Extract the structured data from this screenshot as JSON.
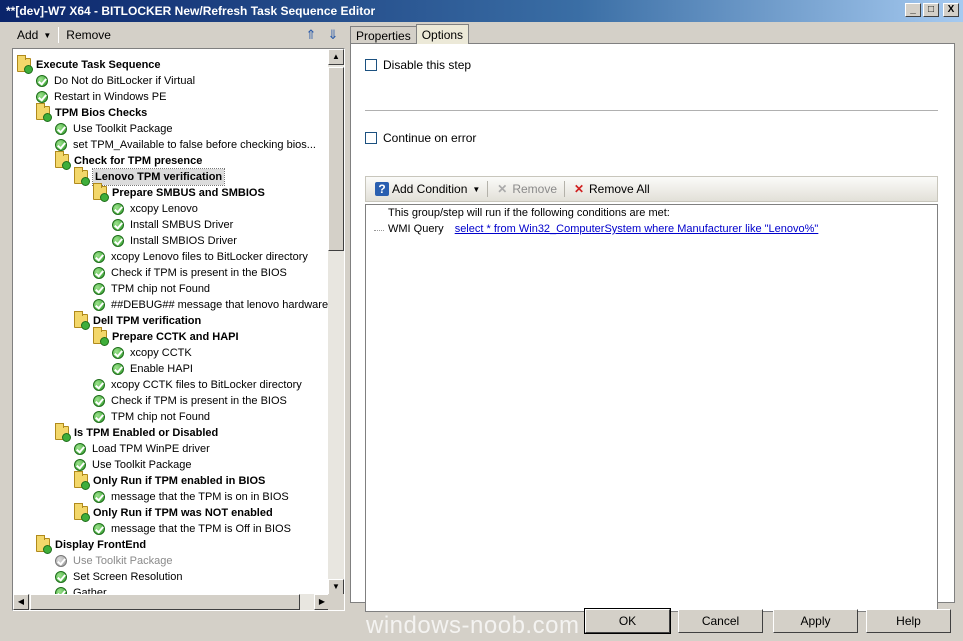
{
  "window": {
    "title": "**[dev]-W7 X64 - BITLOCKER New/Refresh Task Sequence Editor",
    "controls": [
      "_",
      "□",
      "X"
    ]
  },
  "left_toolbar": {
    "add_label": "Add",
    "remove_label": "Remove"
  },
  "tree": [
    {
      "label": "Execute Task Sequence",
      "type": "group",
      "level": 0
    },
    {
      "label": "Do Not do BitLocker if Virtual",
      "type": "step",
      "level": 1
    },
    {
      "label": "Restart in Windows PE",
      "type": "step",
      "level": 1
    },
    {
      "label": "TPM Bios Checks",
      "type": "group",
      "level": 1
    },
    {
      "label": "Use Toolkit Package",
      "type": "step",
      "level": 2
    },
    {
      "label": "set TPM_Available to false before checking bios...",
      "type": "step",
      "level": 2
    },
    {
      "label": "Check for TPM presence",
      "type": "group",
      "level": 2
    },
    {
      "label": "Lenovo TPM verification",
      "type": "group",
      "level": 3,
      "selected": true
    },
    {
      "label": "Prepare SMBUS and SMBIOS",
      "type": "group",
      "level": 4
    },
    {
      "label": "xcopy Lenovo",
      "type": "step",
      "level": 5
    },
    {
      "label": "Install SMBUS Driver",
      "type": "step",
      "level": 5
    },
    {
      "label": "Install SMBIOS Driver",
      "type": "step",
      "level": 5
    },
    {
      "label": "xcopy Lenovo files to BitLocker directory",
      "type": "step",
      "level": 4
    },
    {
      "label": "Check if TPM is present in the BIOS",
      "type": "step",
      "level": 4
    },
    {
      "label": "TPM chip not Found",
      "type": "step",
      "level": 4
    },
    {
      "label": "##DEBUG## message that lenovo hardware",
      "type": "step",
      "level": 4
    },
    {
      "label": "Dell TPM verification",
      "type": "group",
      "level": 3
    },
    {
      "label": "Prepare CCTK and HAPI",
      "type": "group",
      "level": 4
    },
    {
      "label": "xcopy CCTK",
      "type": "step",
      "level": 5
    },
    {
      "label": "Enable HAPI",
      "type": "step",
      "level": 5
    },
    {
      "label": "xcopy CCTK files to BitLocker directory",
      "type": "step",
      "level": 4
    },
    {
      "label": "Check if TPM is present in the BIOS",
      "type": "step",
      "level": 4
    },
    {
      "label": "TPM chip not Found",
      "type": "step",
      "level": 4
    },
    {
      "label": "Is TPM Enabled or Disabled",
      "type": "group",
      "level": 2
    },
    {
      "label": "Load TPM WinPE driver",
      "type": "step",
      "level": 3
    },
    {
      "label": "Use Toolkit Package",
      "type": "step",
      "level": 3
    },
    {
      "label": "Only Run if TPM enabled in BIOS",
      "type": "group",
      "level": 3
    },
    {
      "label": "message that the  TPM is on in BIOS",
      "type": "step",
      "level": 4
    },
    {
      "label": "Only Run if TPM was NOT enabled",
      "type": "group",
      "level": 3
    },
    {
      "label": "message that the  TPM is Off in BIOS",
      "type": "step",
      "level": 4
    },
    {
      "label": "Display FrontEnd",
      "type": "group",
      "level": 1
    },
    {
      "label": "Use Toolkit Package",
      "type": "step",
      "level": 2,
      "disabled": true
    },
    {
      "label": "Set Screen Resolution",
      "type": "step",
      "level": 2
    },
    {
      "label": "Gather",
      "type": "step",
      "level": 2
    }
  ],
  "tabs": {
    "properties": "Properties",
    "options": "Options"
  },
  "options": {
    "disable_step": "Disable this step",
    "continue_on_error": "Continue on error"
  },
  "condition_toolbar": {
    "add_condition": "Add Condition",
    "remove": "Remove",
    "remove_all": "Remove All"
  },
  "conditions": {
    "header": "This group/step will run if the following conditions are met:",
    "items": [
      {
        "type": "WMI Query",
        "value": "select *  from Win32_ComputerSystem where Manufacturer like \"Lenovo%\""
      }
    ]
  },
  "buttons": {
    "ok": "OK",
    "cancel": "Cancel",
    "apply": "Apply",
    "help": "Help"
  },
  "watermark": "windows-noob.com"
}
